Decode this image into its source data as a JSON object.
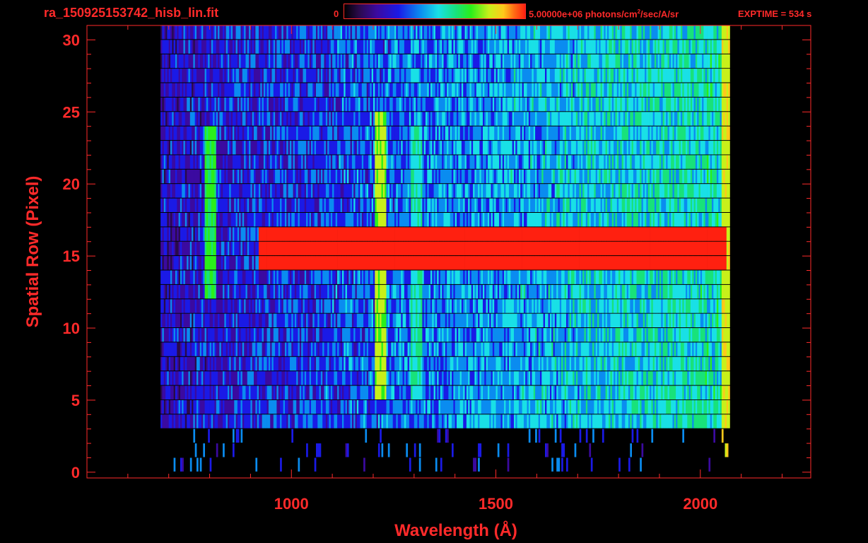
{
  "header": {
    "filename": "ra_150925153742_hisb_lin.fit",
    "colorbar_min": "0",
    "colorbar_units_prefix": "5.00000e+06 photons/cm",
    "colorbar_units_sup": "2",
    "colorbar_units_suffix": "/sec/A/sr",
    "exptime": "EXPTIME = 534 s"
  },
  "colors": {
    "axis": "#ff2a2a",
    "background": "#000000",
    "colormap": [
      "#000000",
      "#2a0a4a",
      "#3b0aa0",
      "#1a1ae6",
      "#0a8cf0",
      "#19e0e6",
      "#18e27a",
      "#2aef1a",
      "#c8f01a",
      "#ffc81a",
      "#ff6a14",
      "#ff2010"
    ]
  },
  "chart_data": {
    "type": "heatmap",
    "title": "",
    "xlabel": "Wavelength (Å)",
    "ylabel": "Spatial Row (Pixel)",
    "xlim": [
      500,
      2270
    ],
    "ylim": [
      -0.4,
      31
    ],
    "xticks": [
      1000,
      1500,
      2000
    ],
    "yticks": [
      0,
      5,
      10,
      15,
      20,
      25,
      30
    ],
    "colorbar_range": [
      0,
      5000000
    ],
    "grid": false,
    "rows": 31,
    "detector_coverage": {
      "x_start": 680,
      "x_end": 2070,
      "row_start": 3,
      "row_end": 30
    },
    "features": [
      {
        "label": "bright continuum",
        "x_start": 920,
        "x_end": 2060,
        "rows": [
          14,
          16
        ],
        "level": 1.0
      },
      {
        "label": "emission line",
        "x": 1216,
        "rows": [
          5,
          24
        ],
        "level": 0.7
      },
      {
        "label": "emission line",
        "x": 1304,
        "rows": [
          5,
          23
        ],
        "level": 0.5
      },
      {
        "label": "emission arc",
        "x": 800,
        "rows": [
          12,
          23
        ],
        "level": 0.6
      },
      {
        "label": "long-wavelength edge",
        "x": 2060,
        "rows": [
          1,
          30
        ],
        "level": 0.75
      }
    ]
  }
}
